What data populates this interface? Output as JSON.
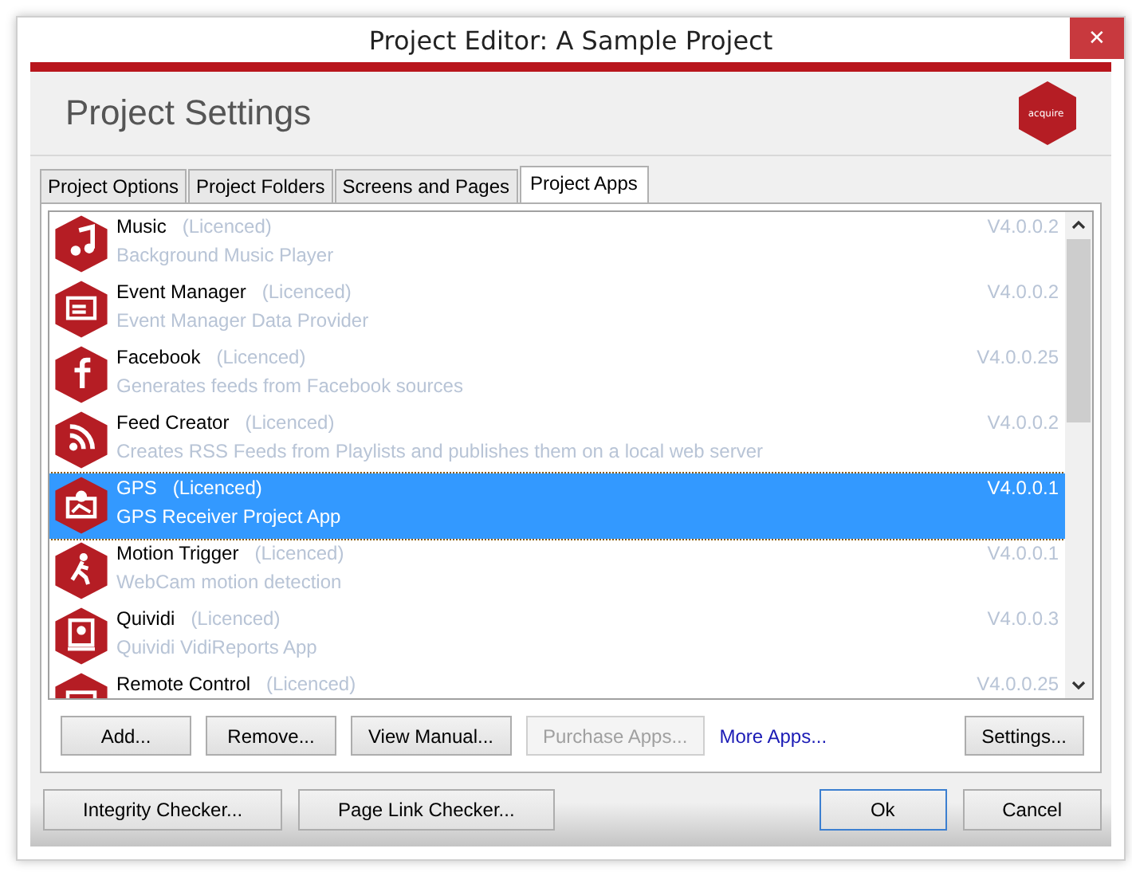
{
  "window": {
    "title": "Project Editor: A Sample Project",
    "close": "✕"
  },
  "header": {
    "title": "Project Settings",
    "logo": "acquire"
  },
  "tabs": [
    {
      "label": "Project Options",
      "selected": false
    },
    {
      "label": "Project Folders",
      "selected": false
    },
    {
      "label": "Screens and Pages",
      "selected": false
    },
    {
      "label": "Project Apps",
      "selected": true
    }
  ],
  "apps": [
    {
      "name": "Music",
      "status": "(Licenced)",
      "description": "Background Music Player",
      "version": "V4.0.0.2",
      "selected": false
    },
    {
      "name": "Event Manager",
      "status": "(Licenced)",
      "description": "Event Manager Data Provider",
      "version": "V4.0.0.2",
      "selected": false
    },
    {
      "name": "Facebook",
      "status": "(Licenced)",
      "description": "Generates feeds from Facebook sources",
      "version": "V4.0.0.25",
      "selected": false
    },
    {
      "name": "Feed Creator",
      "status": "(Licenced)",
      "description": "Creates RSS Feeds from Playlists and publishes them on a local web server",
      "version": "V4.0.0.2",
      "selected": false
    },
    {
      "name": "GPS",
      "status": "(Licenced)",
      "description": "GPS Receiver Project App",
      "version": "V4.0.0.1",
      "selected": true
    },
    {
      "name": "Motion Trigger",
      "status": "(Licenced)",
      "description": "WebCam motion detection",
      "version": "V4.0.0.1",
      "selected": false
    },
    {
      "name": "Quividi",
      "status": "(Licenced)",
      "description": "Quividi VidiReports App",
      "version": "V4.0.0.3",
      "selected": false
    },
    {
      "name": "Remote Control",
      "status": "(Licenced)",
      "version": "V4.0.0.25",
      "selected": false
    }
  ],
  "app_buttons": [
    {
      "label": "Add...",
      "kind": "button"
    },
    {
      "label": "Remove...",
      "kind": "button"
    },
    {
      "label": "View Manual...",
      "kind": "button"
    },
    {
      "label": "Purchase Apps...",
      "kind": "disabled-button"
    },
    {
      "label": "More Apps...",
      "kind": "link"
    },
    {
      "label": "Settings...",
      "kind": "spacer-button"
    }
  ],
  "footer": {
    "left_buttons": [
      {
        "label": "Integrity Checker...",
        "default": false
      },
      {
        "label": "Page Link Checker...",
        "default": false
      }
    ],
    "right_buttons": [
      {
        "label": "Ok",
        "default": true
      },
      {
        "label": "Cancel",
        "default": false
      }
    ]
  }
}
